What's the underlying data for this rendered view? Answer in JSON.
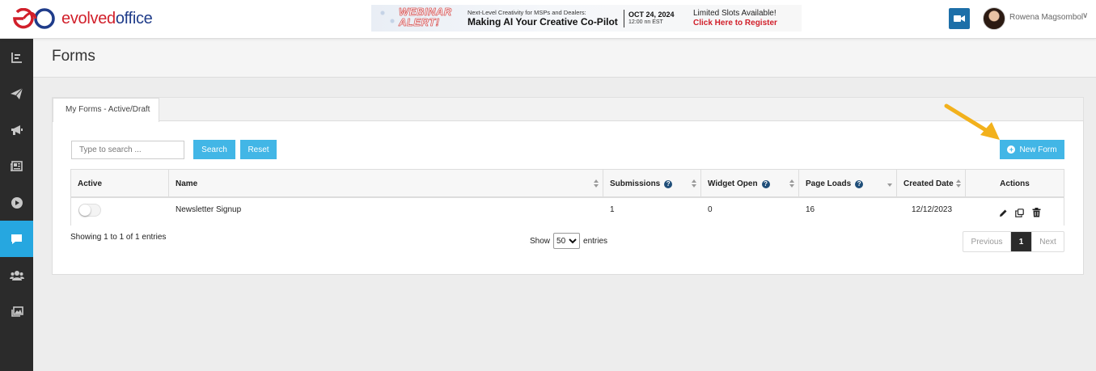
{
  "header": {
    "logo_text_a": "evolved",
    "logo_text_b": "office",
    "banner": {
      "alert_line1": "WEBINAR",
      "alert_line2": "ALERT!",
      "subtitle": "Next-Level Creativity for MSPs and Dealers:",
      "title": "Making AI Your Creative Co-Pilot",
      "date": "OCT 24, 2024",
      "time": "12:00 nn EST",
      "slots": "Limited Slots Available!",
      "register": "Click Here to Register"
    },
    "user_name": "Rowena Magsombol",
    "user_chevron": "∨"
  },
  "sidebar": {
    "items": [
      {
        "icon": "dashboard-chart-icon"
      },
      {
        "icon": "paper-plane-icon"
      },
      {
        "icon": "megaphone-icon"
      },
      {
        "icon": "newspaper-icon"
      },
      {
        "icon": "play-circle-icon"
      },
      {
        "icon": "chat-bubble-icon",
        "active": true
      },
      {
        "icon": "users-icon"
      },
      {
        "icon": "images-icon"
      }
    ],
    "active_color": "#26a7e0"
  },
  "page": {
    "title": "Forms"
  },
  "tabs": [
    {
      "label": "My Forms - Active/Draft",
      "active": true
    }
  ],
  "toolbar": {
    "search_placeholder": "Type to search ...",
    "search_label": "Search",
    "reset_label": "Reset",
    "new_form_label": "New Form",
    "new_form_icon": "➕"
  },
  "table": {
    "columns": [
      {
        "label": "Active"
      },
      {
        "label": "Name"
      },
      {
        "label": "Submissions",
        "help": "?"
      },
      {
        "label": "Widget Open",
        "help": "?"
      },
      {
        "label": "Page Loads",
        "help": "?"
      },
      {
        "label": "Created Date"
      },
      {
        "label": "Actions"
      }
    ],
    "rows": [
      {
        "active": false,
        "name": "Newsletter Signup",
        "submissions": "1",
        "widget_open": "0",
        "page_loads": "16",
        "created_date": "12/12/2023"
      }
    ]
  },
  "footer": {
    "info": "Showing 1 to 1 of 1 entries",
    "show_label": "Show",
    "page_size": "50",
    "entries_label": "entries",
    "prev_label": "Previous",
    "current_page": "1",
    "next_label": "Next"
  },
  "colors": {
    "accent": "#42b6e6",
    "brand_red": "#d11f2a",
    "brand_navy": "#1f3c8a",
    "sidebar_bg": "#2b2b2b",
    "help_icon": "#1f4e79",
    "arrow": "#f2b11c"
  }
}
